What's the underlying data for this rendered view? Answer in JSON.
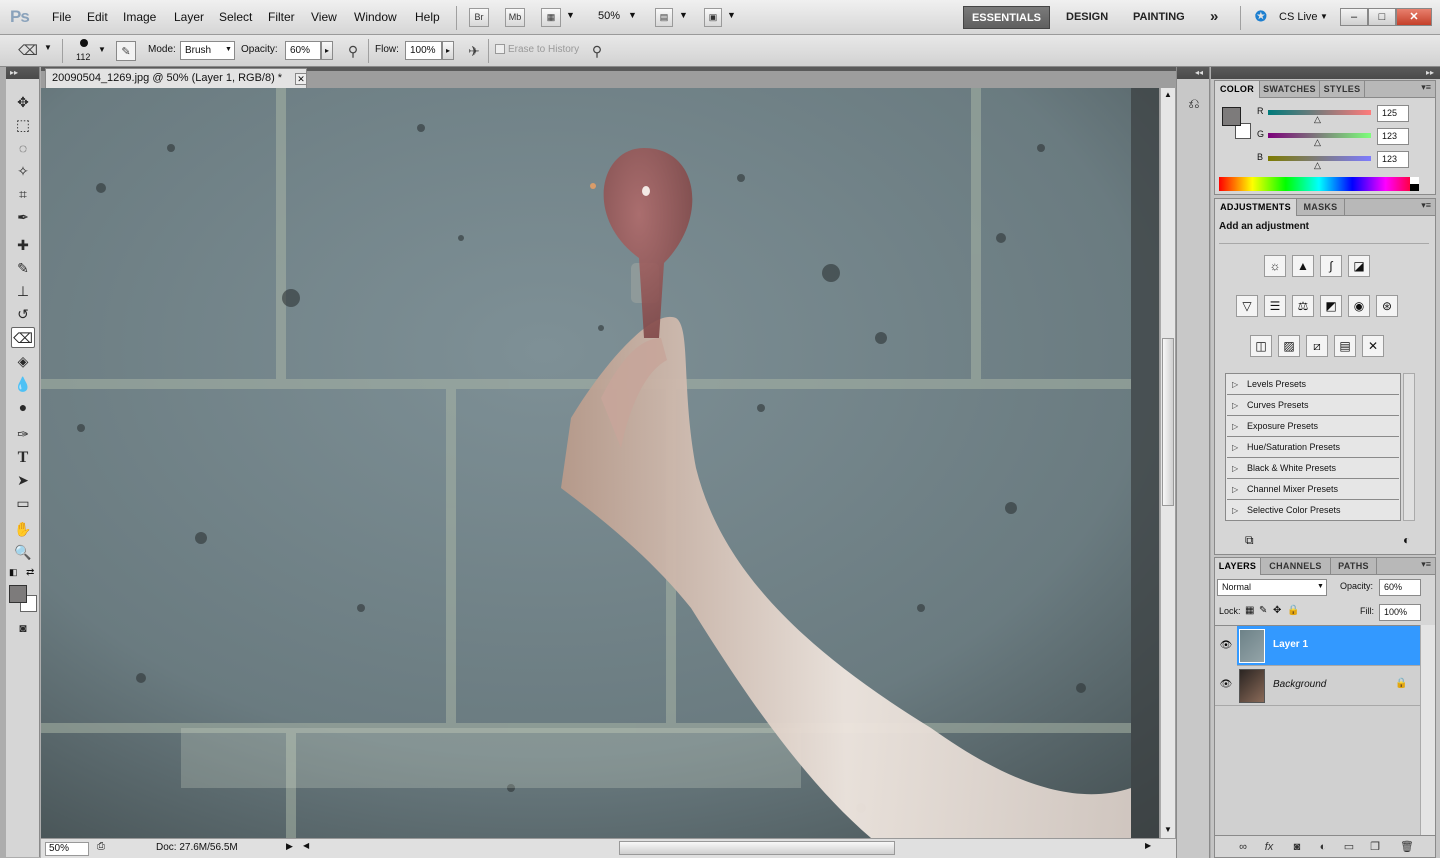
{
  "app": {
    "logo": "Ps",
    "menus": [
      "File",
      "Edit",
      "Image",
      "Layer",
      "Select",
      "Filter",
      "View",
      "Window",
      "Help"
    ],
    "bridge_button": "Br",
    "minibridge_button": "Mb",
    "zoom": "50%",
    "workspaces": [
      "ESSENTIALS",
      "DESIGN",
      "PAINTING"
    ],
    "more_workspaces": "»",
    "cs_live": "CS Live",
    "win_min": "–",
    "win_max": "□",
    "win_close": "✕"
  },
  "options": {
    "brush_size": "112",
    "mode_label": "Mode:",
    "mode_value": "Brush",
    "opacity_label": "Opacity:",
    "opacity_value": "60%",
    "flow_label": "Flow:",
    "flow_value": "100%",
    "erase_history": "Erase to History"
  },
  "document": {
    "tab_title": "20090504_1269.jpg @ 50% (Layer 1, RGB/8) *",
    "status_zoom": "50%",
    "status_doc": "Doc: 27.6M/56.5M"
  },
  "color_panel": {
    "tabs": [
      "COLOR",
      "SWATCHES",
      "STYLES"
    ],
    "channels": [
      {
        "label": "R",
        "value": "125"
      },
      {
        "label": "G",
        "value": "123"
      },
      {
        "label": "B",
        "value": "123"
      }
    ],
    "foreground_color": "#7d7b7b"
  },
  "adjustments_panel": {
    "tabs": [
      "ADJUSTMENTS",
      "MASKS"
    ],
    "heading": "Add an adjustment",
    "presets": [
      "Levels Presets",
      "Curves Presets",
      "Exposure Presets",
      "Hue/Saturation Presets",
      "Black & White Presets",
      "Channel Mixer Presets",
      "Selective Color Presets"
    ]
  },
  "layers_panel": {
    "tabs": [
      "LAYERS",
      "CHANNELS",
      "PATHS"
    ],
    "blend_mode": "Normal",
    "opacity_label": "Opacity:",
    "opacity_value": "60%",
    "lock_label": "Lock:",
    "fill_label": "Fill:",
    "fill_value": "100%",
    "layers": [
      {
        "name": "Layer 1",
        "selected": true
      },
      {
        "name": "Background",
        "selected": false,
        "locked": true
      }
    ]
  },
  "colors": {
    "selection": "#3399ff",
    "workspace_active": "#666666"
  }
}
